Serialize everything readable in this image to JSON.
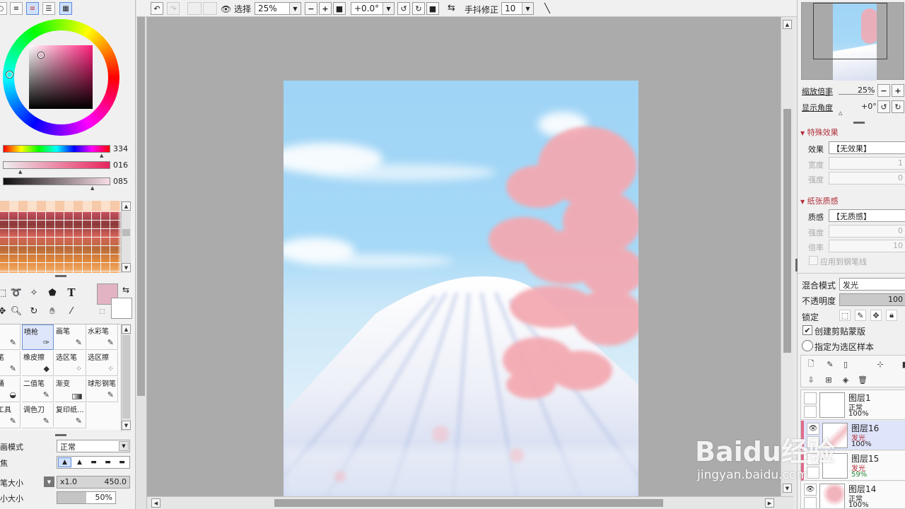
{
  "left_panel": {
    "color_sliders": [
      {
        "value": "334"
      },
      {
        "value": "016"
      },
      {
        "value": "085"
      }
    ],
    "brushes": [
      {
        "label": "笔"
      },
      {
        "label": "喷枪"
      },
      {
        "label": "画笔"
      },
      {
        "label": "水彩笔"
      },
      {
        "label": "亮笔"
      },
      {
        "label": "橡皮擦"
      },
      {
        "label": "选区笔"
      },
      {
        "label": "选区擦"
      },
      {
        "label": "漆桶"
      },
      {
        "label": "二值笔"
      },
      {
        "label": "渐变"
      },
      {
        "label": "球形钢笔"
      },
      {
        "label": "糊工具"
      },
      {
        "label": "调色刀"
      },
      {
        "label": "复印纸..."
      }
    ],
    "blend_label": "画模式",
    "blend_value": "正常",
    "focus_label": "焦",
    "brush_size_label": "笔大小",
    "brush_size_mult": "x1.0",
    "brush_size_value": "450.0",
    "min_size_label": "小大小",
    "min_size_value": "50%",
    "text_tool_glyph": "T"
  },
  "toolbar": {
    "selection_label": "选择",
    "zoom_value": "25%",
    "rotation_value": "+0.0°",
    "stabilizer_label": "手抖修正",
    "stabilizer_value": "10"
  },
  "navigator": {
    "zoom_label": "缩放倍率",
    "zoom_value": "25%",
    "angle_label": "显示角度",
    "angle_value": "+0°"
  },
  "effects": {
    "section_title": "特殊效果",
    "effect_label": "效果",
    "effect_value": "【无效果】",
    "width_label": "宽度",
    "width_value": "1",
    "strength_label": "强度",
    "strength_value": "0"
  },
  "paper": {
    "section_title": "纸张质感",
    "texture_label": "质感",
    "texture_value": "【无质感】",
    "strength_label": "强度",
    "strength_value": "0",
    "scale_label": "倍率",
    "scale_value": "10",
    "apply_pen_label": "应用到钢笔线"
  },
  "layer_props": {
    "blend_label": "混合模式",
    "blend_value": "发光",
    "opacity_label": "不透明度",
    "opacity_value": "100",
    "lock_label": "锁定",
    "clip_label": "创建剪贴蒙版",
    "sample_label": "指定为选区样本"
  },
  "layers": [
    {
      "name": "图层1",
      "mode": "正常",
      "opacity": "100%"
    },
    {
      "name": "图层16",
      "mode": "发光",
      "opacity": "100%"
    },
    {
      "name": "图层15",
      "mode": "发光",
      "opacity": "59%"
    },
    {
      "name": "图层14",
      "mode": "正常",
      "opacity": "100%"
    }
  ],
  "watermark": {
    "logo": "Baidu经验",
    "url": "jingyan.baidu.com"
  },
  "colors": {
    "accent_red": "#b0303a",
    "selected_blue": "#dfe4fb",
    "current_color": "#e2b4c3"
  }
}
